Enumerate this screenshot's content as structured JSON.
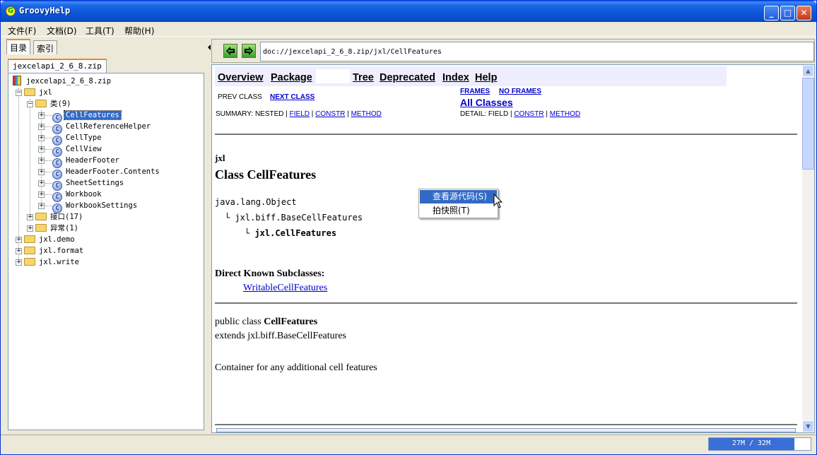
{
  "window": {
    "title": "GroovyHelp"
  },
  "menu": [
    "文件(F)",
    "文档(D)",
    "工具(T)",
    "帮助(H)"
  ],
  "left_tabs": [
    "目录",
    "索引"
  ],
  "sub_tab": "jexcelapi_2_6_8.zip",
  "tree": {
    "root": "jexcelapi_2_6_8.zip",
    "jxl": "jxl",
    "classes_folder": "类(9)",
    "classes": [
      "CellFeatures",
      "CellReferenceHelper",
      "CellType",
      "CellView",
      "HeaderFooter",
      "HeaderFooter.Contents",
      "SheetSettings",
      "Workbook",
      "WorkbookSettings"
    ],
    "selected_class": "CellFeatures",
    "interfaces_folder": "接口(17)",
    "exceptions_folder": "异常(1)",
    "packages": [
      "jxl.demo",
      "jxl.format",
      "jxl.write"
    ]
  },
  "address": "doc://jexcelapi_2_6_8.zip/jxl/CellFeatures",
  "doc": {
    "nav": [
      "Overview",
      "Package",
      "Tree",
      "Deprecated",
      "Index",
      "Help"
    ],
    "prev_class": "PREV CLASS",
    "next_class": "NEXT CLASS",
    "frames": "FRAMES",
    "no_frames": "NO FRAMES",
    "all_classes": "All Classes",
    "summary_prefix": "SUMMARY: NESTED |",
    "summary_field": "FIELD",
    "summary_constr": "CONSTR",
    "summary_method": "METHOD",
    "detail_prefix": "DETAIL: FIELD |",
    "detail_constr": "CONSTR",
    "detail_method": "METHOD",
    "sep": "|",
    "package": "jxl",
    "class_title": "Class CellFeatures",
    "hierarchy": [
      "java.lang.Object",
      "jxl.biff.BaseCellFeatures",
      "jxl.CellFeatures"
    ],
    "subclasses_label": "Direct Known Subclasses:",
    "subclass": "WritableCellFeatures",
    "decl_prefix": "public class ",
    "decl_name": "CellFeatures",
    "extends": "extends jxl.biff.BaseCellFeatures",
    "description": "Container for any additional cell features"
  },
  "context_menu": [
    "查看源代码(S)",
    "拍快照(T)"
  ],
  "status": {
    "memory_text": "27M / 32M",
    "memory_fraction": 0.84
  },
  "colors": {
    "title_bar": "#0a55d6",
    "selection": "#316ac5",
    "link": "#0000cc"
  }
}
